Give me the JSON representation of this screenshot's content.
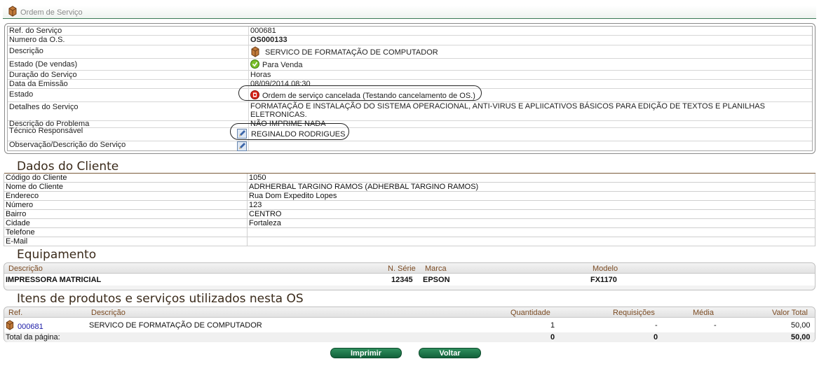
{
  "page": {
    "title": "Ordem de Serviço"
  },
  "service": {
    "rows": [
      {
        "label": "Ref. do Serviço",
        "value": "000681"
      },
      {
        "label": "Numero da O.S.",
        "value": "OS000133"
      },
      {
        "label": "Descrição",
        "value": "SERVICO DE FORMATAÇÃO DE COMPUTADOR"
      },
      {
        "label": "Estado (De vendas)",
        "value": "Para Venda"
      },
      {
        "label": "Duração do Serviço",
        "value": "Horas"
      },
      {
        "label": "Data da Emissão",
        "value": "08/09/2014 08:30"
      },
      {
        "label": "Estado",
        "value": "Ordem de serviço cancelada (Testando cancelamento de OS.)"
      },
      {
        "label": "Detalhes do Serviço",
        "value": "FORMATAÇÃO E INSTALAÇÃO DO SISTEMA OPERACIONAL, ANTI-VIRUS E APLIICATIVOS BÁSICOS PARA EDIÇÃO DE TEXTOS E PLANILHAS ELETRONICAS."
      },
      {
        "label": "Descrição do Problema",
        "value": "NÃO IMPRIME NADA"
      },
      {
        "label": "Técnico Responsável",
        "value": "REGINALDO RODRIGUES"
      },
      {
        "label": "Observação/Descrição do Serviço",
        "value": ""
      }
    ]
  },
  "client": {
    "heading": "Dados do Cliente",
    "rows": [
      {
        "label": "Código do Cliente",
        "value": "1050"
      },
      {
        "label": "Nome do Cliente",
        "value": "ADRHERBAL TARGINO RAMOS (ADHERBAL TARGINO RAMOS)"
      },
      {
        "label": "Endereco",
        "value": "Rua Dom Expedito Lopes"
      },
      {
        "label": "Número",
        "value": "123"
      },
      {
        "label": "Bairro",
        "value": "CENTRO"
      },
      {
        "label": "Cidade",
        "value": "Fortaleza"
      },
      {
        "label": "Telefone",
        "value": ""
      },
      {
        "label": "E-Mail",
        "value": ""
      }
    ]
  },
  "equipment": {
    "heading": "Equipamento",
    "headers": {
      "descricao": "Descrição",
      "serie": "N. Série",
      "marca": "Marca",
      "modelo": "Modelo"
    },
    "row": {
      "descricao": "IMPRESSORA MATRICIAL",
      "serie": "12345",
      "marca": "EPSON",
      "modelo": "FX1170"
    }
  },
  "items": {
    "heading": "Itens de produtos e serviços utilizados nesta OS",
    "headers": {
      "ref": "Ref.",
      "descricao": "Descrição",
      "quantidade": "Quantidade",
      "requisicoes": "Requisições",
      "media": "Média",
      "valor_total": "Valor Total"
    },
    "row": {
      "ref": "000681",
      "descricao": "SERVICO DE FORMATAÇÃO DE COMPUTADOR",
      "quantidade": "1",
      "requisicoes": "-",
      "media": "-",
      "valor_total": "50,00"
    },
    "footer": {
      "label": "Total da página:",
      "quantidade": "0",
      "requisicoes": "0",
      "valor_total": "50,00"
    }
  },
  "buttons": {
    "print": "Imprimir",
    "back": "Voltar"
  },
  "colors": {
    "accent": "#12613a",
    "heading": "#3a2a1a",
    "link": "#1a1aa6",
    "cancel": "#d9261c"
  }
}
